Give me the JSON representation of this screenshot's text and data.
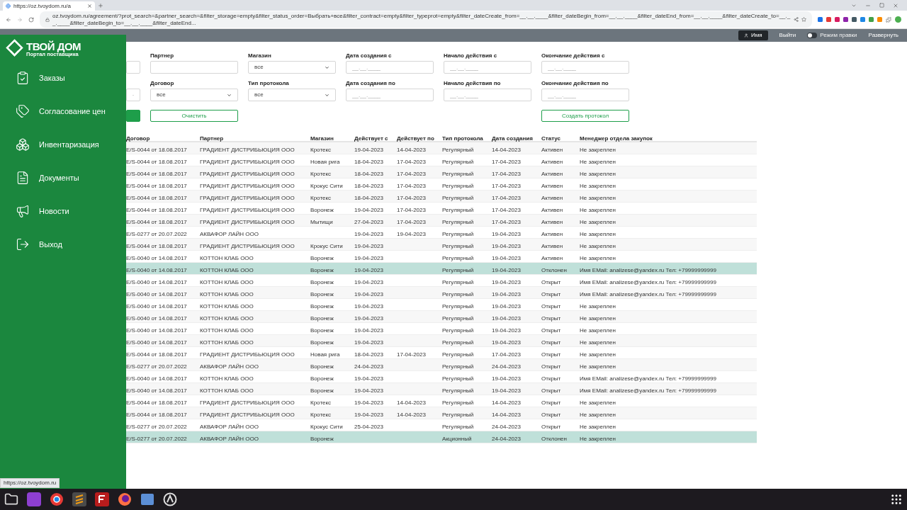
{
  "browser": {
    "tab_title": "https://oz.tvoydom.ru/a",
    "url": "oz.tvoydom.ru/agreement/?prot_search=&partner_search=&filter_storage=empty&filter_status_order=Выбрать+все&filter_contract=empty&filter_typeprot=empty&filter_dateCreate_from=__.__.____&filter_dateBegin_from=__.__.____&filter_dateEnd_from=__.__.____&filter_dateCreate_to=__.__.____&filter_dateBegin_to=__.__.____&filter_dateEnd...",
    "status_url": "https://oz.tvoydom.ru"
  },
  "header": {
    "user": "Имя",
    "logout": "Выйти",
    "edit_mode": {
      "label": "Режим правки",
      "on": false
    },
    "expand": "Развернуть"
  },
  "sidebar": {
    "logo_title": "ТВОЙ ДОМ",
    "logo_subtitle": "Портал поставщика",
    "items": [
      {
        "label": "Заказы"
      },
      {
        "label": "Согласование цен"
      },
      {
        "label": "Инвентаризация"
      },
      {
        "label": "Документы"
      },
      {
        "label": "Новости"
      },
      {
        "label": "Выход"
      }
    ]
  },
  "filters": [
    {
      "kind": "text"
    },
    {
      "kind": "text",
      "label": "Партнер"
    },
    {
      "kind": "select",
      "label": "Магазин",
      "value": "все"
    },
    {
      "kind": "date",
      "label": "Дата создания с",
      "placeholder": "__.__.____"
    },
    {
      "kind": "date",
      "label": "Начало действия с",
      "placeholder": "__.__.____"
    },
    {
      "kind": "date",
      "label": "Окончание действия с",
      "placeholder": "__.__.____"
    },
    {
      "kind": "select"
    },
    {
      "kind": "select",
      "label": "Договор",
      "value": "все"
    },
    {
      "kind": "select",
      "label": "Тип протокола",
      "value": "все"
    },
    {
      "kind": "date",
      "label": "Дата создания по",
      "placeholder": "__.__.____"
    },
    {
      "kind": "date",
      "label": "Начало действия по",
      "placeholder": "__.__.____"
    },
    {
      "kind": "date",
      "label": "Окончание действия по",
      "placeholder": "__.__.____"
    }
  ],
  "buttons": [
    {
      "kind": "primary"
    },
    {
      "kind": "outline",
      "label": "Очистить"
    },
    {
      "kind": "outline",
      "label": "Создать протокол"
    }
  ],
  "table": {
    "columns": [
      "Договор",
      "Партнер",
      "Магазин",
      "Действует с",
      "Действует по",
      "Тип протокола",
      "Дата создания",
      "Статус",
      "Менеджер отдела закупок"
    ],
    "rows": [
      {
        "cells": [
          "E/S-0044 от 18.08.2017",
          "ГРАДИЕНТ ДИСТРИБЬЮЦИЯ ООО",
          "Кротекс",
          "19-04-2023",
          "14-04-2023",
          "Регулярный",
          "14-04-2023",
          "Активен",
          "Не закреплен"
        ],
        "selected": false
      },
      {
        "cells": [
          "E/S-0044 от 18.08.2017",
          "ГРАДИЕНТ ДИСТРИБЬЮЦИЯ ООО",
          "Новая рига",
          "18-04-2023",
          "17-04-2023",
          "Регулярный",
          "17-04-2023",
          "Активен",
          "Не закреплен"
        ],
        "selected": false
      },
      {
        "cells": [
          "E/S-0044 от 18.08.2017",
          "ГРАДИЕНТ ДИСТРИБЬЮЦИЯ ООО",
          "Кротекс",
          "18-04-2023",
          "17-04-2023",
          "Регулярный",
          "17-04-2023",
          "Активен",
          "Не закреплен"
        ],
        "selected": false
      },
      {
        "cells": [
          "E/S-0044 от 18.08.2017",
          "ГРАДИЕНТ ДИСТРИБЬЮЦИЯ ООО",
          "Крокус Сити",
          "18-04-2023",
          "17-04-2023",
          "Регулярный",
          "17-04-2023",
          "Активен",
          "Не закреплен"
        ],
        "selected": false
      },
      {
        "cells": [
          "E/S-0044 от 18.08.2017",
          "ГРАДИЕНТ ДИСТРИБЬЮЦИЯ ООО",
          "Кротекс",
          "18-04-2023",
          "17-04-2023",
          "Регулярный",
          "17-04-2023",
          "Активен",
          "Не закреплен"
        ],
        "selected": false
      },
      {
        "cells": [
          "E/S-0044 от 18.08.2017",
          "ГРАДИЕНТ ДИСТРИБЬЮЦИЯ ООО",
          "Воронеж",
          "19-04-2023",
          "17-04-2023",
          "Регулярный",
          "17-04-2023",
          "Активен",
          "Не закреплен"
        ],
        "selected": false
      },
      {
        "cells": [
          "E/S-0044 от 18.08.2017",
          "ГРАДИЕНТ ДИСТРИБЬЮЦИЯ ООО",
          "Мытищи",
          "27-04-2023",
          "17-04-2023",
          "Регулярный",
          "17-04-2023",
          "Активен",
          "Не закреплен"
        ],
        "selected": false
      },
      {
        "cells": [
          "E/S-0277 от 20.07.2022",
          "АКВАФОР ЛАЙН ООО",
          null,
          "19-04-2023",
          "19-04-2023",
          "Регулярный",
          "19-04-2023",
          "Активен",
          "Не закреплен"
        ],
        "selected": false
      },
      {
        "cells": [
          "E/S-0044 от 18.08.2017",
          "ГРАДИЕНТ ДИСТРИБЬЮЦИЯ ООО",
          "Крокус Сити",
          "19-04-2023",
          null,
          "Регулярный",
          "19-04-2023",
          "Активен",
          "Не закреплен"
        ],
        "selected": false
      },
      {
        "cells": [
          "E/S-0040 от 14.08.2017",
          "КОТТОН КЛАБ ООО",
          "Воронеж",
          "19-04-2023",
          null,
          "Регулярный",
          "19-04-2023",
          "Активен",
          "Не закреплен"
        ],
        "selected": false
      },
      {
        "cells": [
          "E/S-0040 от 14.08.2017",
          "КОТТОН КЛАБ ООО",
          "Воронеж",
          "19-04-2023",
          null,
          "Регулярный",
          "19-04-2023",
          "Отклонен",
          "Имя EMail: analizese@yandex.ru Тел: +79999999999"
        ],
        "selected": true
      },
      {
        "cells": [
          "E/S-0040 от 14.08.2017",
          "КОТТОН КЛАБ ООО",
          "Воронеж",
          "19-04-2023",
          null,
          "Регулярный",
          "19-04-2023",
          "Открыт",
          "Имя EMail: analizese@yandex.ru Тел: +79999999999"
        ],
        "selected": false
      },
      {
        "cells": [
          "E/S-0040 от 14.08.2017",
          "КОТТОН КЛАБ ООО",
          "Воронеж",
          "19-04-2023",
          null,
          "Регулярный",
          "19-04-2023",
          "Открыт",
          "Имя EMail: analizese@yandex.ru Тел: +79999999999"
        ],
        "selected": false
      },
      {
        "cells": [
          "E/S-0040 от 14.08.2017",
          "КОТТОН КЛАБ ООО",
          "Воронеж",
          "19-04-2023",
          null,
          "Регулярный",
          "19-04-2023",
          "Открыт",
          "Не закреплен"
        ],
        "selected": false
      },
      {
        "cells": [
          "E/S-0040 от 14.08.2017",
          "КОТТОН КЛАБ ООО",
          "Воронеж",
          "19-04-2023",
          null,
          "Регулярный",
          "19-04-2023",
          "Открыт",
          "Не закреплен"
        ],
        "selected": false
      },
      {
        "cells": [
          "E/S-0040 от 14.08.2017",
          "КОТТОН КЛАБ ООО",
          "Воронеж",
          "19-04-2023",
          null,
          "Регулярный",
          "19-04-2023",
          "Открыт",
          "Не закреплен"
        ],
        "selected": false
      },
      {
        "cells": [
          "E/S-0040 от 14.08.2017",
          "КОТТОН КЛАБ ООО",
          "Воронеж",
          "19-04-2023",
          null,
          "Регулярный",
          "19-04-2023",
          "Открыт",
          "Не закреплен"
        ],
        "selected": false
      },
      {
        "cells": [
          "E/S-0044 от 18.08.2017",
          "ГРАДИЕНТ ДИСТРИБЬЮЦИЯ ООО",
          "Новая рига",
          "18-04-2023",
          "17-04-2023",
          "Регулярный",
          "17-04-2023",
          "Открыт",
          "Не закреплен"
        ],
        "selected": false
      },
      {
        "cells": [
          "E/S-0277 от 20.07.2022",
          "АКВАФОР ЛАЙН ООО",
          "Воронеж",
          "24-04-2023",
          null,
          "Регулярный",
          "24-04-2023",
          "Открыт",
          "Не закреплен"
        ],
        "selected": false
      },
      {
        "cells": [
          "E/S-0040 от 14.08.2017",
          "КОТТОН КЛАБ ООО",
          "Воронеж",
          "19-04-2023",
          null,
          "Регулярный",
          "19-04-2023",
          "Открыт",
          "Имя EMail: analizese@yandex.ru Тел: +79999999999"
        ],
        "selected": false
      },
      {
        "cells": [
          "E/S-0040 от 14.08.2017",
          "КОТТОН КЛАБ ООО",
          "Воронеж",
          "19-04-2023",
          null,
          "Регулярный",
          "19-04-2023",
          "Открыт",
          "Имя EMail: analizese@yandex.ru Тел: +79999999999"
        ],
        "selected": false
      },
      {
        "cells": [
          "E/S-0044 от 18.08.2017",
          "ГРАДИЕНТ ДИСТРИБЬЮЦИЯ ООО",
          "Кротекс",
          "19-04-2023",
          "14-04-2023",
          "Регулярный",
          "14-04-2023",
          "Открыт",
          "Не закреплен"
        ],
        "selected": false
      },
      {
        "cells": [
          "E/S-0044 от 18.08.2017",
          "ГРАДИЕНТ ДИСТРИБЬЮЦИЯ ООО",
          "Кротекс",
          "19-04-2023",
          "14-04-2023",
          "Регулярный",
          "14-04-2023",
          "Открыт",
          "Не закреплен"
        ],
        "selected": false
      },
      {
        "cells": [
          "E/S-0277 от 20.07.2022",
          "АКВАФОР ЛАЙН ООО",
          "Крокус Сити",
          "25-04-2023",
          null,
          "Регулярный",
          "24-04-2023",
          "Открыт",
          "Не закреплен"
        ],
        "selected": false
      },
      {
        "cells": [
          "E/S-0277 от 20.07.2022",
          "АКВАФОР ЛАЙН ООО",
          "Воронеж",
          null,
          null,
          "Акционный",
          "24-04-2023",
          "Отклонен",
          "Не закреплен"
        ],
        "selected": true
      }
    ]
  }
}
